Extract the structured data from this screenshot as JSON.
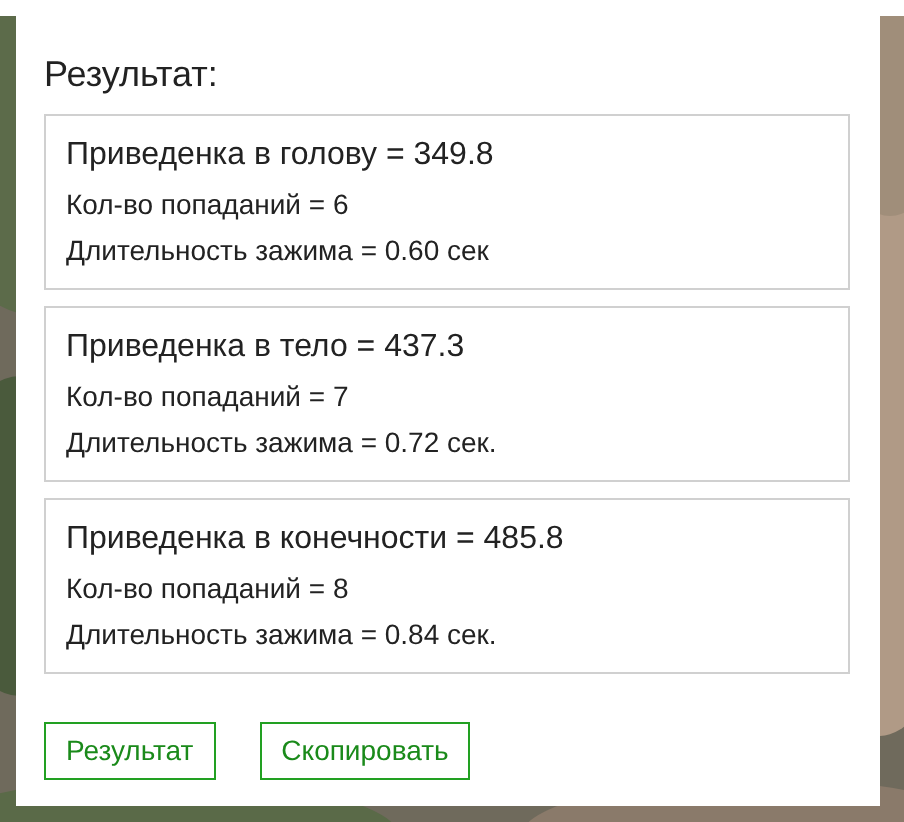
{
  "title": "Результат:",
  "results": [
    {
      "heading": "Приведенка в голову = 349.8",
      "lines": [
        "Кол-во попаданий = 6",
        "Длительность зажима = 0.60 сек"
      ]
    },
    {
      "heading": "Приведенка в тело = 437.3",
      "lines": [
        "Кол-во попаданий = 7",
        "Длительность зажима = 0.72 сек."
      ]
    },
    {
      "heading": "Приведенка в конечности = 485.8",
      "lines": [
        "Кол-во попаданий = 8",
        "Длительность зажима = 0.84 сек."
      ]
    }
  ],
  "buttons": [
    "Результат",
    "Скопировать"
  ]
}
